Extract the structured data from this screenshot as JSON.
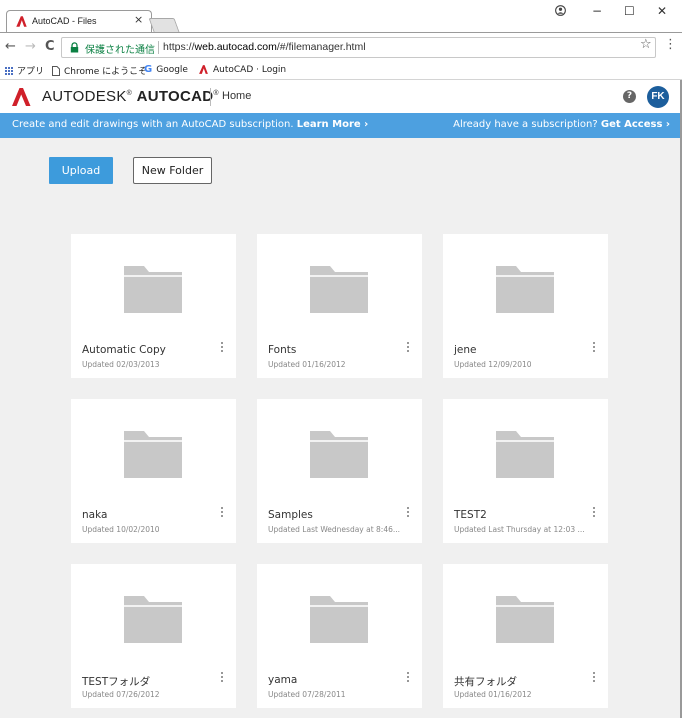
{
  "browser": {
    "tab_title": "AutoCAD - Files",
    "tab_close": "×",
    "window_minimize": "−",
    "window_maximize": "☐",
    "window_close": "✕",
    "account_icon": "person-circle-icon",
    "back": "←",
    "forward": "→",
    "reload": "C",
    "secure_label": "保護された通信",
    "url_prefix": "https://",
    "url_host": "web.autocad.com",
    "url_path": "/#/filemanager.html",
    "bookmark_star": "☆",
    "menu": "⋮",
    "bookmarks": [
      {
        "label": "アプリ",
        "icon": "apps-grid-icon"
      },
      {
        "label": "Chrome にようこそ",
        "icon": "page-icon"
      },
      {
        "label": "Google",
        "icon": "google-icon"
      },
      {
        "label": "AutoCAD · Login",
        "icon": "autocad-logo-icon"
      }
    ]
  },
  "header": {
    "brand_light": "AUTODESK",
    "brand_reg": "®",
    "brand_bold": "AUTOCAD",
    "brand_reg2": "®",
    "home": "Home",
    "help": "?",
    "avatar_initials": "FK"
  },
  "banner": {
    "text": "Create and edit drawings with an AutoCAD subscription.",
    "learn_more": "Learn More ›",
    "have_sub": "Already have a subscription?",
    "get_access": "Get Access ›"
  },
  "toolbar": {
    "upload": "Upload",
    "new_folder": "New Folder"
  },
  "folders": [
    {
      "name": "Automatic Copy",
      "updated": "Updated 02/03/2013"
    },
    {
      "name": "Fonts",
      "updated": "Updated 01/16/2012"
    },
    {
      "name": "jene",
      "updated": "Updated 12/09/2010"
    },
    {
      "name": "naka",
      "updated": "Updated 10/02/2010"
    },
    {
      "name": "Samples",
      "updated": "Updated Last Wednesday at 8:46..."
    },
    {
      "name": "TEST2",
      "updated": "Updated Last Thursday at 12:03 ..."
    },
    {
      "name": "TESTフォルダ",
      "updated": "Updated 07/26/2012"
    },
    {
      "name": "yama",
      "updated": "Updated 07/28/2011"
    },
    {
      "name": "共有フォルダ",
      "updated": "Updated 01/16/2012"
    }
  ],
  "colors": {
    "brand_red": "#d0202a",
    "banner_blue": "#4da0e0",
    "upload_blue": "#3d9bdc",
    "avatar_blue": "#1c5e9c",
    "folder_gray": "#c8c8c8"
  }
}
